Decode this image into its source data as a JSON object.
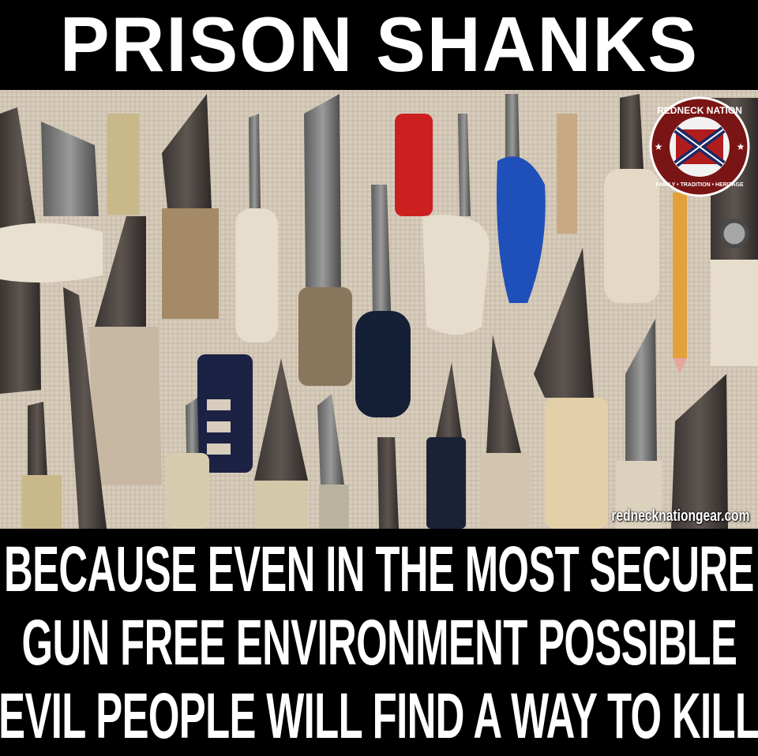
{
  "headline": "PRISON SHANKS",
  "caption_lines": [
    "BECAUSE EVEN IN THE MOST SECURE",
    "GUN FREE ENVIRONMENT POSSIBLE",
    "EVIL PEOPLE WILL FIND A WAY TO KILL"
  ],
  "watermark": "rednecknationgear.com",
  "badge": {
    "top_text": "REDNECK NATION",
    "bottom_text": "FAMILY • TRADITION • HERITAGE"
  },
  "colors": {
    "background": "#000000",
    "text": "#ffffff",
    "burlap": "#d9cfc0"
  }
}
